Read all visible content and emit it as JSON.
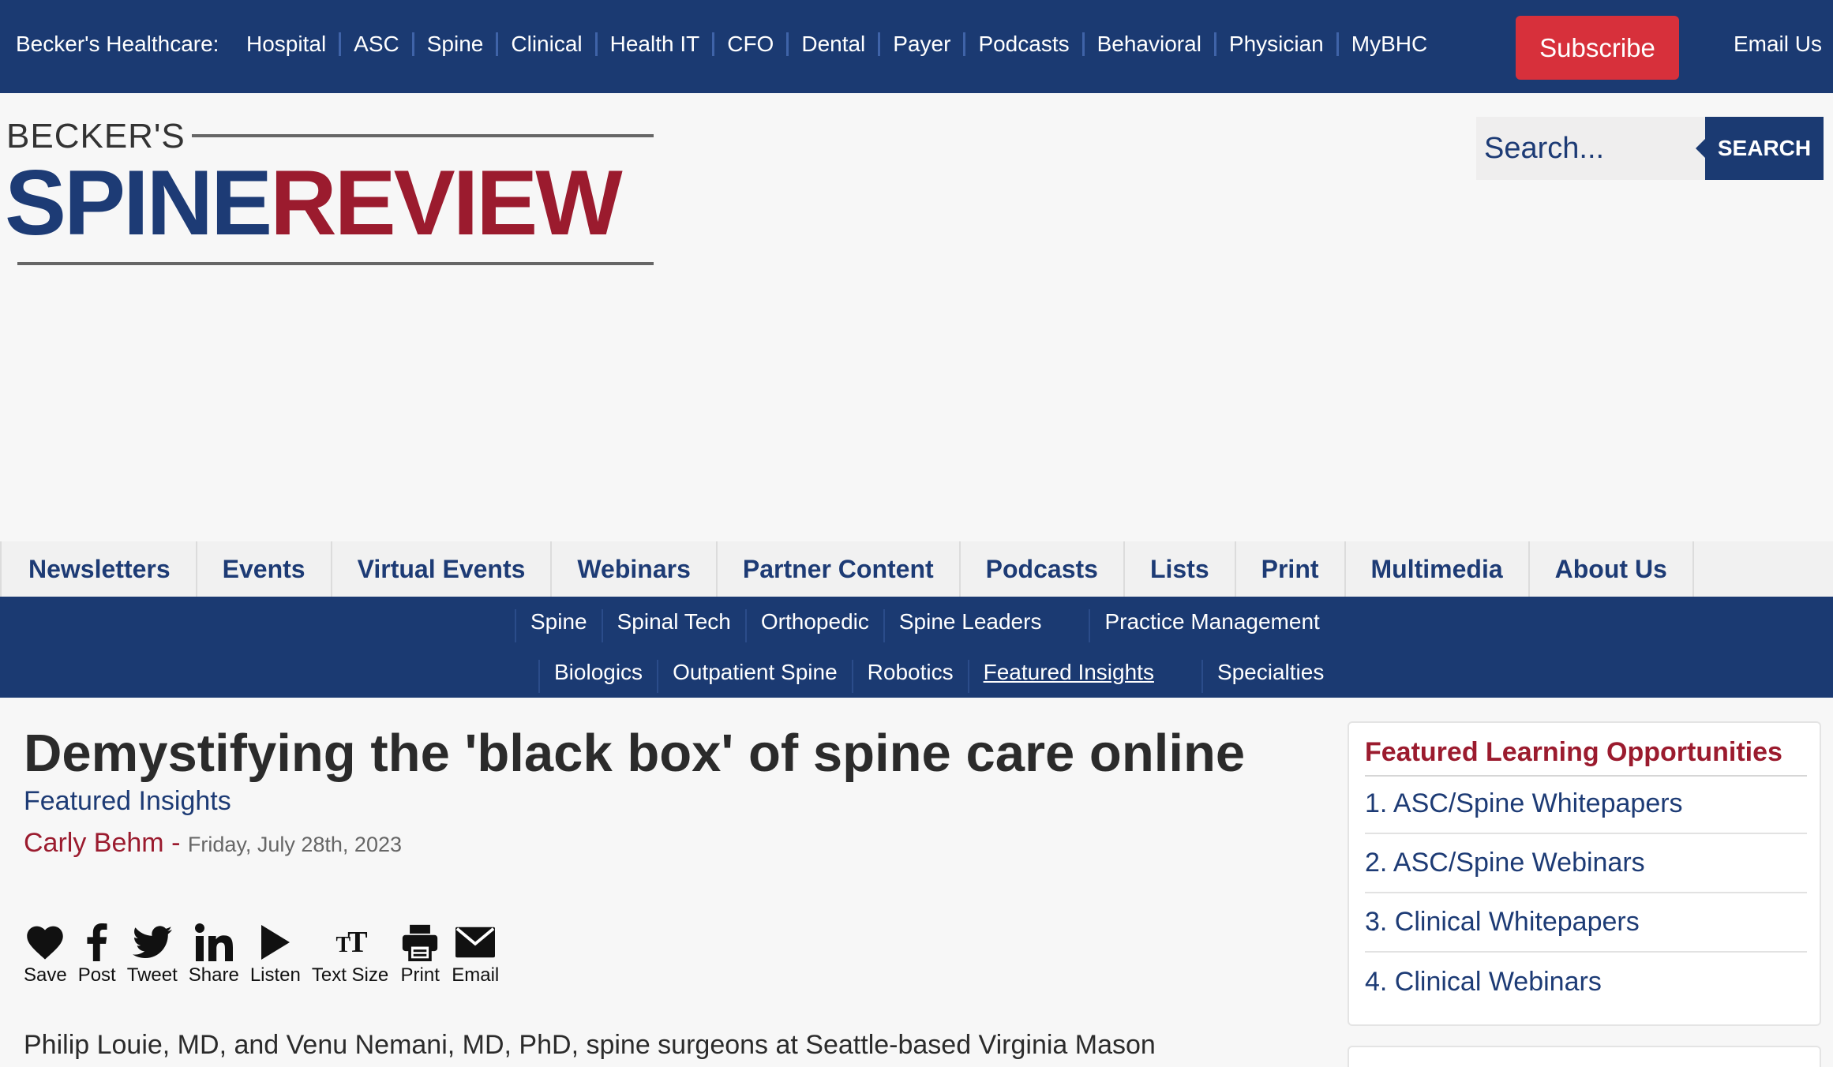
{
  "topbar": {
    "brand": "Becker's Healthcare:",
    "links": [
      "Hospital",
      "ASC",
      "Spine",
      "Clinical",
      "Health IT",
      "CFO",
      "Dental",
      "Payer",
      "Podcasts",
      "Behavioral",
      "Physician",
      "MyBHC"
    ],
    "subscribe": "Subscribe",
    "email_us": "Email Us"
  },
  "logo": {
    "beckers": "BECKER'S",
    "spine": "SPINE",
    "review": "REVIEW"
  },
  "search": {
    "placeholder": "Search...",
    "button": "SEARCH"
  },
  "main_nav": [
    "Newsletters",
    "Events",
    "Virtual Events",
    "Webinars",
    "Partner Content",
    "Podcasts",
    "Lists",
    "Print",
    "Multimedia",
    "About Us"
  ],
  "sub_nav": {
    "row1": [
      "Spine",
      "Spinal Tech",
      "Orthopedic",
      "Spine Leaders",
      "Practice Management"
    ],
    "row2": [
      "Biologics",
      "Outpatient Spine",
      "Robotics",
      "Featured Insights",
      "Specialties"
    ],
    "current": "Featured Insights"
  },
  "article": {
    "headline": "Demystifying the 'black box' of spine care online",
    "category": "Featured Insights",
    "author": "Carly Behm",
    "dash": "-",
    "date": "Friday, July 28th, 2023",
    "body_start": "Philip Louie, MD, and Venu Nemani, MD, PhD, spine surgeons at Seattle-based Virginia Mason"
  },
  "share_tools": {
    "save": "Save",
    "post": "Post",
    "tweet": "Tweet",
    "share": "Share",
    "listen": "Listen",
    "text_size": "Text Size",
    "print": "Print",
    "email": "Email"
  },
  "sidebar": {
    "title": "Featured Learning Opportunities",
    "items": [
      "1. ASC/Spine Whitepapers",
      "2. ASC/Spine Webinars",
      "3. Clinical Whitepapers",
      "4. Clinical Webinars"
    ]
  },
  "colors": {
    "navy": "#1b3a72",
    "brand_red": "#9b1b2e",
    "subscribe_red": "#d7303b"
  }
}
